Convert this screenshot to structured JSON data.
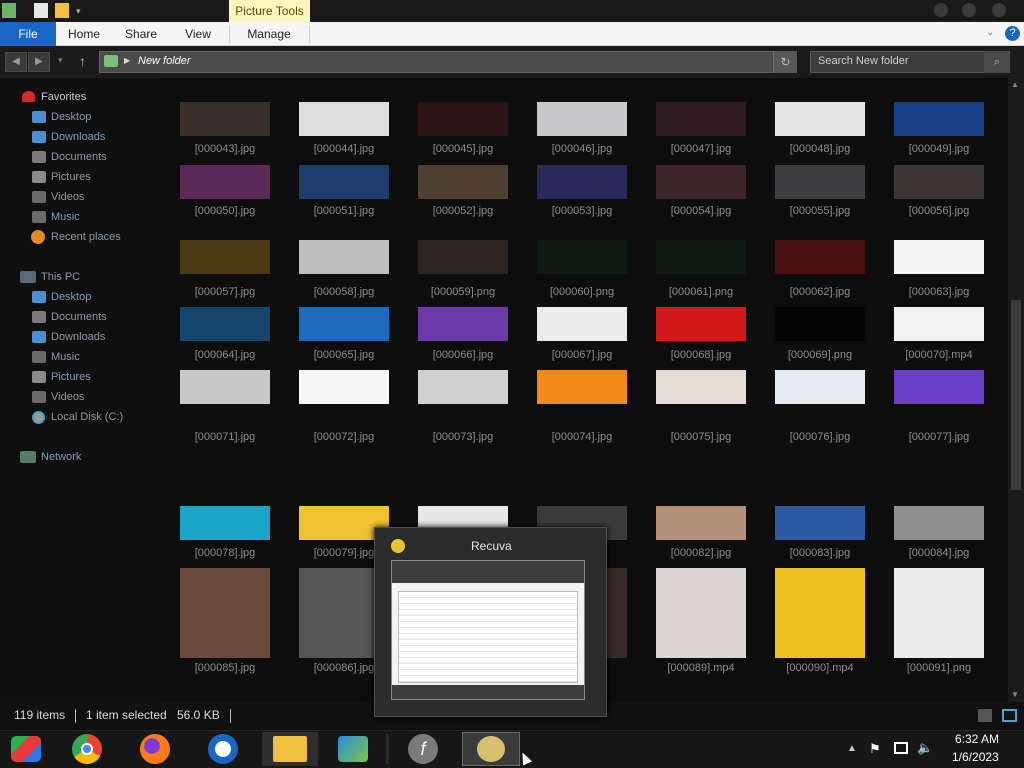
{
  "ribbon": {
    "context_tab": "Picture Tools",
    "tabs": [
      "File",
      "Home",
      "Share",
      "View",
      "Manage"
    ]
  },
  "address": {
    "path": "New folder",
    "search_placeholder": "Search New folder"
  },
  "nav": {
    "favorites_label": "Favorites",
    "favorites": [
      "Desktop",
      "Downloads",
      "Documents",
      "Pictures",
      "Videos",
      "Music",
      "Recent places"
    ],
    "thispc_label": "This PC",
    "thispc": [
      "Desktop",
      "Documents",
      "Downloads",
      "Music",
      "Pictures",
      "Videos",
      "Local Disk (C:)"
    ],
    "network_label": "Network"
  },
  "files": [
    "[000043].jpg",
    "[000044].jpg",
    "[000045].jpg",
    "[000046].jpg",
    "[000047].jpg",
    "[000048].jpg",
    "[000049].jpg",
    "[000050].jpg",
    "[000051].jpg",
    "[000052].jpg",
    "[000053].jpg",
    "[000054].jpg",
    "[000055].jpg",
    "[000056].jpg",
    "[000057].jpg",
    "[000058].jpg",
    "[000059].png",
    "[000060].png",
    "[000061].png",
    "[000062].jpg",
    "[000063].jpg",
    "[000064].jpg",
    "[000065].jpg",
    "[000066].jpg",
    "[000067].jpg",
    "[000068].jpg",
    "[000069].png",
    "[000070].mp4",
    "[000071].jpg",
    "[000072].jpg",
    "[000073].jpg",
    "[000074].jpg",
    "[000075].jpg",
    "[000076].jpg",
    "[000077].jpg",
    "[000078].jpg",
    "[000079].jpg",
    "",
    "",
    "[000082].jpg",
    "[000083].jpg",
    "[000084].jpg",
    "[000085].jpg",
    "[000086].jpg",
    "",
    "",
    "[000089].mp4",
    "[000090].mp4",
    "[000091].png"
  ],
  "thumb_colors": [
    "#3a2f2a",
    "#dcdcdc",
    "#2a1416",
    "#c9c9cc",
    "#2e1c22",
    "#e6e6e6",
    "#1b3f86",
    "#5c2a58",
    "#1d3b6b",
    "#4d4030",
    "#2a2a5a",
    "#3c2428",
    "#3e3e42",
    "#3a3434",
    "#4a3a14",
    "#bebebe",
    "#2c2420",
    "#0e1a14",
    "#0e1a14",
    "#4a1010",
    "#f3f3f3",
    "#16456c",
    "#1d6cc0",
    "#6a3aa8",
    "#ececec",
    "#d21818",
    "#050505",
    "#f2f2f2",
    "#c8c8c8",
    "#f6f6f6",
    "#cfcfcf",
    "#f28a16",
    "#e8dcd6",
    "#e5ebf3",
    "#6a3cc8",
    "#1aa6c8",
    "#f1c230",
    "#e7e7e7",
    "#3a3a3a",
    "#b6917a",
    "#2c5aa0",
    "#8f8f8f",
    "#6a4a3a",
    "#565656",
    "#6a6a6a",
    "#3a2a2a",
    "#dcd7d5",
    "#f0c020",
    "#ececec"
  ],
  "status": {
    "items": "119 items",
    "selected": "1 item selected",
    "size": "56.0 KB"
  },
  "popup": {
    "title": "Recuva"
  },
  "clock": {
    "time": "6:32 AM",
    "date": "1/6/2023"
  },
  "taskbar_apps": [
    "App switcher",
    "Chrome",
    "Firefox",
    "Edge",
    "File Explorer",
    "Network",
    "Flash",
    "Recuva"
  ]
}
